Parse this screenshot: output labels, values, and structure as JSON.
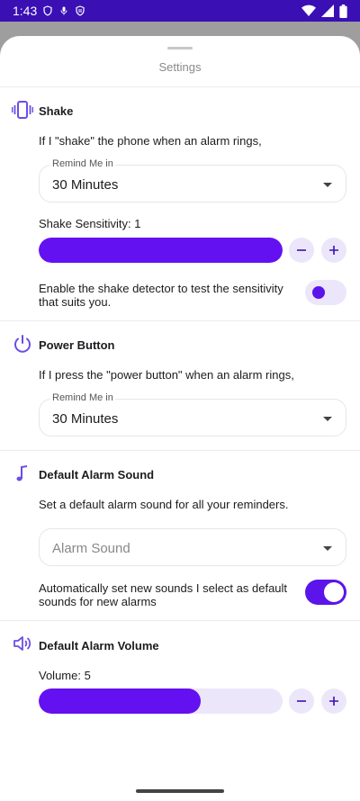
{
  "status": {
    "time": "1:43"
  },
  "sheet": {
    "title": "Settings"
  },
  "shake": {
    "title": "Shake",
    "description": "If I \"shake\" the phone when an alarm rings,",
    "remind_label": "Remind Me in",
    "remind_value": "30 Minutes",
    "sensitivity_label": "Shake Sensitivity: 1",
    "sensitivity_level": 1.0,
    "detector_text": "Enable the shake detector to test the sensitivity that suits you.",
    "detector_enabled": false
  },
  "power": {
    "title": "Power Button",
    "description": "If I press the \"power button\" when an alarm rings,",
    "remind_label": "Remind Me in",
    "remind_value": "30 Minutes"
  },
  "sound": {
    "title": "Default Alarm Sound",
    "description": "Set a default alarm sound for all your reminders.",
    "placeholder": "Alarm Sound",
    "auto_text": "Automatically set new sounds I select as default sounds for new alarms",
    "auto_enabled": true
  },
  "volume": {
    "title": "Default Alarm Volume",
    "label": "Volume: 5",
    "level": 0.665
  },
  "colors": {
    "accent": "#6411f2",
    "status_bar": "#3a10b5",
    "track": "#ece6fb"
  },
  "icons": {
    "shake": "vibration-icon",
    "power": "power-icon",
    "sound": "music-note-icon",
    "volume": "volume-icon",
    "minus": "minus-icon",
    "plus": "plus-icon"
  }
}
